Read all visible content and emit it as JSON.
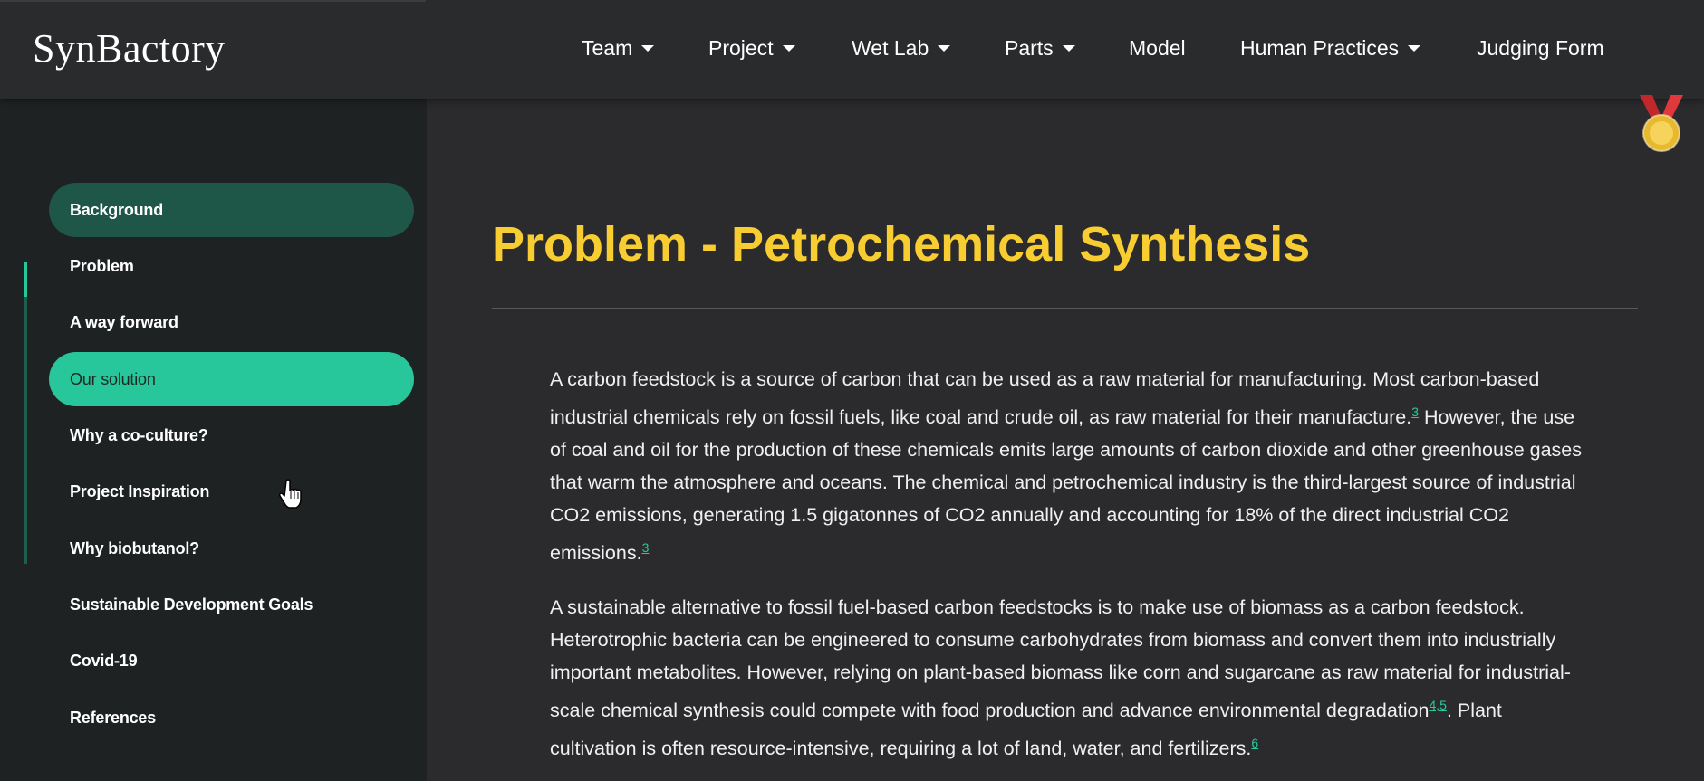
{
  "navbar": {
    "brand": "SynBactory",
    "items": [
      {
        "label": "Team",
        "dropdown": true
      },
      {
        "label": "Project",
        "dropdown": true
      },
      {
        "label": "Wet Lab",
        "dropdown": true
      },
      {
        "label": "Parts",
        "dropdown": true
      },
      {
        "label": "Model",
        "dropdown": false
      },
      {
        "label": "Human Practices",
        "dropdown": true
      },
      {
        "label": "Judging Form",
        "dropdown": false
      }
    ]
  },
  "sidebar": {
    "items": [
      {
        "label": "Background"
      },
      {
        "label": "Problem"
      },
      {
        "label": "A way forward"
      },
      {
        "label": "Our solution"
      },
      {
        "label": "Why a co-culture?"
      },
      {
        "label": "Project Inspiration"
      },
      {
        "label": "Why biobutanol?"
      },
      {
        "label": "Sustainable Development Goals"
      },
      {
        "label": "Covid-19"
      },
      {
        "label": "References"
      }
    ],
    "active": "Our solution",
    "section_highlight": "Background"
  },
  "main": {
    "title": "Problem - Petrochemical Synthesis",
    "para1": {
      "t1": "A carbon feedstock is a source of carbon that can be used as a raw material for manufacturing. Most carbon-based industrial chemicals rely on fossil fuels, like coal and crude oil, as raw material for their manufacture.",
      "ref1": "3",
      "t2": " However, the use of coal and oil for the production of these chemicals emits large amounts of carbon dioxide and other greenhouse gases that warm the atmosphere and oceans. The chemical and petrochemical industry is the third-largest source of industrial CO2 emissions, generating 1.5 gigatonnes of CO2 annually and accounting for 18% of the direct industrial CO2 emissions.",
      "ref2": "3"
    },
    "para2": {
      "t1": "A sustainable alternative to fossil fuel-based carbon feedstocks is to make use of biomass as a carbon feedstock. Heterotrophic bacteria can be engineered to consume carbohydrates from biomass and convert them into industrially important metabolites. However, relying on plant-based biomass like corn and sugarcane as raw material for industrial-scale chemical synthesis could compete with food production and advance environmental degradation",
      "ref1": "4,5",
      "t2": ". Plant cultivation is often resource-intensive, requiring a lot of land, water, and fertilizers.",
      "ref2": "6"
    }
  },
  "colors": {
    "accent_green": "#27c69b",
    "section_green": "#1e5747",
    "title_yellow": "#f7cd31",
    "link_green": "#29c99d"
  },
  "icons": [
    "caret-down-icon",
    "hand-pointer-cursor-icon",
    "medal-icon"
  ]
}
